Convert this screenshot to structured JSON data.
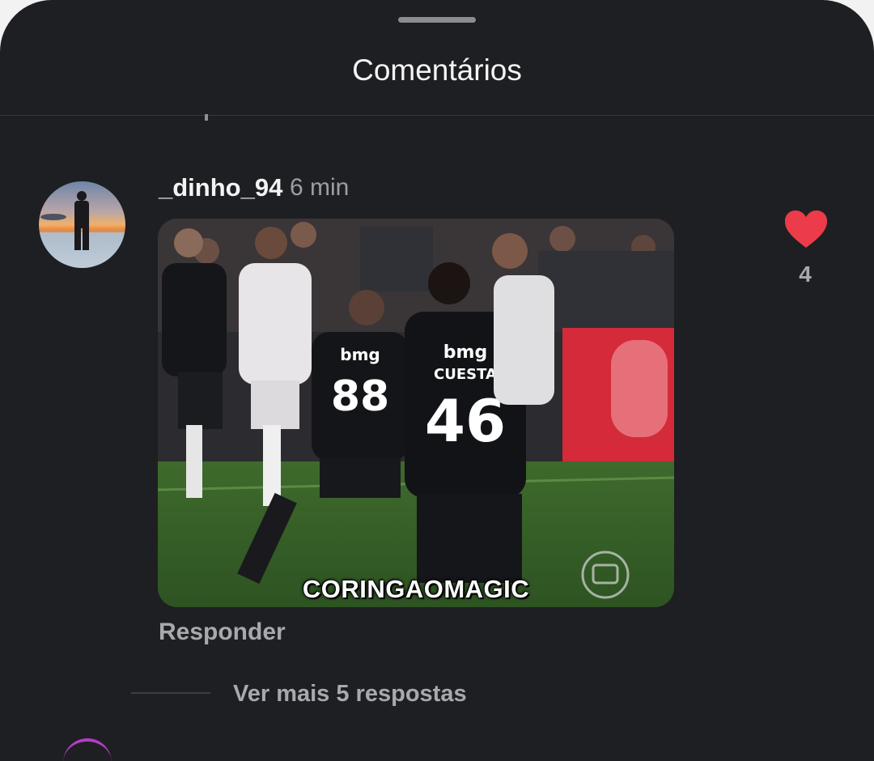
{
  "sheet": {
    "title": "Comentários"
  },
  "comment": {
    "username": "_dinho_94",
    "time": "6 min",
    "gif": {
      "caption": "CORINGAOMAGIC"
    },
    "likes": "4",
    "reply_label": "Responder"
  },
  "replies": {
    "more_label": "Ver mais 5 respostas"
  },
  "colors": {
    "sheet_background": "#1e1f22",
    "like_heart": "#ec3b49",
    "secondary_text": "#a7a9af"
  },
  "icons": {
    "like": "heart-icon"
  }
}
